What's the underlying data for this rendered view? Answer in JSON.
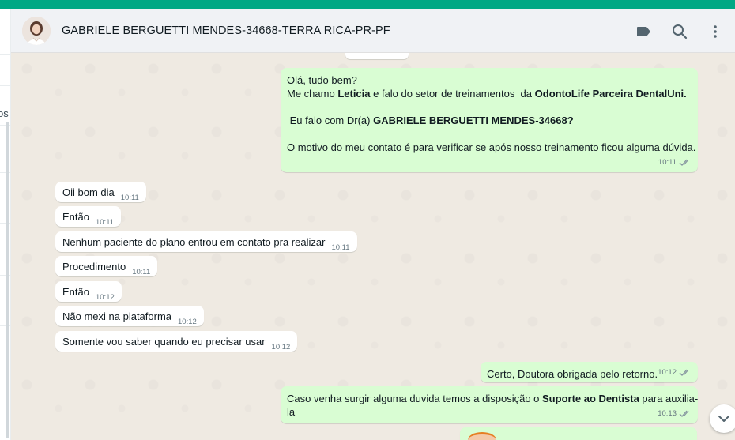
{
  "header": {
    "contact_name": "GABRIELE BERGUETTI MENDES-34668-TERRA RICA-PR-PF",
    "avatar_icon": "profile-photo",
    "actions": [
      "label-icon",
      "search-icon",
      "more-vertical-icon"
    ]
  },
  "left_panel": {
    "fragment_text": "os"
  },
  "messages": [
    {
      "direction": "outgoing",
      "lines": [
        [
          {
            "t": "Olá, tudo bem?"
          }
        ],
        [
          {
            "t": "Me chamo "
          },
          {
            "t": "Leticia",
            "b": true
          },
          {
            "t": " e falo do setor de treinamentos  da "
          },
          {
            "t": "OdontoLife Parceira DentalUni.",
            "b": true
          }
        ],
        [],
        [
          {
            "t": " Eu falo com Dr(a) "
          },
          {
            "t": "GABRIELE BERGUETTI MENDES-34668?",
            "b": true
          }
        ],
        [],
        [
          {
            "t": "O motivo do meu contato é para verificar se após nosso treinamento ficou alguma dúvida."
          }
        ]
      ],
      "time": "10:11",
      "status": "read"
    },
    {
      "direction": "incoming",
      "text": "Oii bom dia",
      "time": "10:11"
    },
    {
      "direction": "incoming",
      "text": "Então",
      "time": "10:11"
    },
    {
      "direction": "incoming",
      "text": "Nenhum paciente do plano entrou em contato pra realizar",
      "time": "10:11"
    },
    {
      "direction": "incoming",
      "text": "Procedimento",
      "time": "10:11"
    },
    {
      "direction": "incoming",
      "text": "Então",
      "time": "10:12"
    },
    {
      "direction": "incoming",
      "text": "Não mexi na plataforma",
      "time": "10:12"
    },
    {
      "direction": "incoming",
      "text": "Somente vou saber quando eu precisar usar",
      "time": "10:12"
    },
    {
      "direction": "outgoing",
      "lines": [
        [
          {
            "t": "Certo, Doutora obrigada pelo retorno."
          }
        ]
      ],
      "time": "10:12",
      "status": "read"
    },
    {
      "direction": "outgoing",
      "lines": [
        [
          {
            "t": "Caso venha surgir alguma duvida temos a disposição o "
          },
          {
            "t": "Suporte ao Dentista",
            "b": true
          },
          {
            "t": " para auxilia-"
          }
        ],
        [
          {
            "t": "la"
          }
        ]
      ],
      "time": "10:13",
      "status": "read"
    }
  ],
  "colors": {
    "accent": "#00a884",
    "outgoing_bubble": "#d9fdd3",
    "incoming_bubble": "#ffffff",
    "chat_background": "#efeae2",
    "read_ticks": "#8696a0"
  },
  "scroll_down_icon": "chevron-down-icon"
}
